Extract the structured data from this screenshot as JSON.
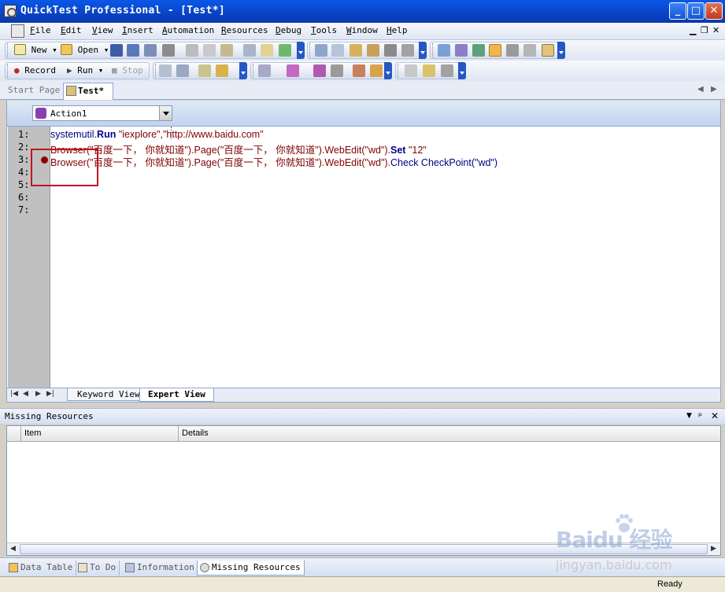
{
  "window": {
    "title": "QuickTest Professional - [Test*]"
  },
  "menu": {
    "items": [
      {
        "label": "File",
        "u": "F"
      },
      {
        "label": "Edit",
        "u": "E"
      },
      {
        "label": "View",
        "u": "V"
      },
      {
        "label": "Insert",
        "u": "I"
      },
      {
        "label": "Automation",
        "u": "A"
      },
      {
        "label": "Resources",
        "u": "R"
      },
      {
        "label": "Debug",
        "u": "D"
      },
      {
        "label": "Tools",
        "u": "T"
      },
      {
        "label": "Window",
        "u": "W"
      },
      {
        "label": "Help",
        "u": "H"
      }
    ]
  },
  "toolbar": {
    "new_label": "New",
    "open_label": "Open",
    "record_label": "Record",
    "run_label": "Run",
    "stop_label": "Stop"
  },
  "tabs": {
    "start_page": "Start Page",
    "test": "Test*"
  },
  "action_select": {
    "value": "Action1"
  },
  "editor": {
    "line_numbers": [
      "1:",
      "2:",
      "3:",
      "4:",
      "5:",
      "6:",
      "7:"
    ],
    "lines": [
      [
        {
          "t": "systemutil.",
          "c": "c-id"
        },
        {
          "t": "Run",
          "c": "c-kw"
        },
        {
          "t": " \"iexplore\",\"http://www.baidu.com\"",
          "c": "c-str"
        }
      ],
      [
        {
          "t": "Browser(\"百度一下， 你就知道\").Page(\"百度一下， 你就知道\").",
          "c": "c-str"
        },
        {
          "t": "WebEdit(\"wd\").",
          "c": "c-str"
        },
        {
          "t": "Set",
          "c": "c-kw"
        },
        {
          "t": " \"12\"",
          "c": "c-str"
        }
      ],
      [
        {
          "t": "Browser(\"百度一下， 你就知道\").Page(\"百度一下， 你就知道\").",
          "c": "c-str"
        },
        {
          "t": "WebEdit(\"wd\").",
          "c": "c-str"
        },
        {
          "t": "Check CheckPoint(\"wd\")",
          "c": "c-id"
        }
      ]
    ]
  },
  "view_tabs": {
    "keyword": "Keyword View",
    "expert": "Expert View"
  },
  "missing_resources": {
    "title": "Missing Resources",
    "columns": [
      "Item",
      "Details"
    ]
  },
  "bottom_tabs": [
    "Data Table",
    "To Do",
    "Information",
    "Missing Resources"
  ],
  "status": {
    "text": "Ready"
  },
  "watermark": {
    "logo": "Baidu 经验",
    "url": "jingyan.baidu.com"
  },
  "colors": {
    "title_bar": "#0843c4",
    "breakpoint": "#8b0000",
    "highlight_box": "#c0161e",
    "keyword": "#00008b",
    "string": "#800000"
  }
}
